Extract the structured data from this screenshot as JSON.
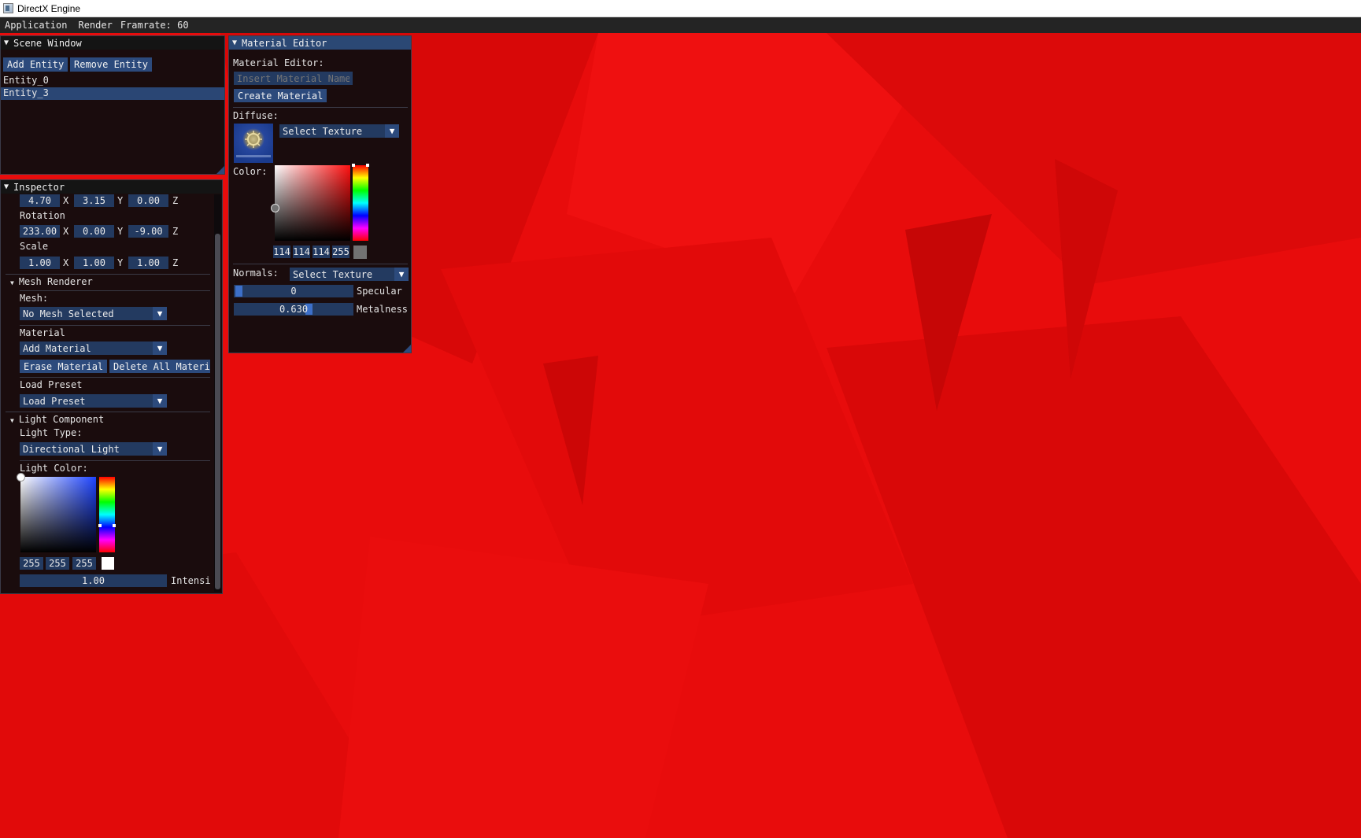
{
  "window": {
    "title": "DirectX Engine"
  },
  "menubar": {
    "items": [
      "Application",
      "Render"
    ],
    "framerate": "Framrate: 60"
  },
  "scene_window": {
    "title": "Scene Window",
    "add_button": "Add Entity",
    "remove_button": "Remove Entity",
    "entities": [
      "Entity_0",
      "Entity_3"
    ],
    "selected_entity": "Entity_3"
  },
  "inspector": {
    "title": "Inspector",
    "position": {
      "x": "4.70",
      "y": "3.15",
      "z": "0.00"
    },
    "rotation_label": "Rotation",
    "rotation": {
      "x": "233.00",
      "y": "0.00",
      "z": "-9.00"
    },
    "scale_label": "Scale",
    "scale": {
      "x": "1.00",
      "y": "1.00",
      "z": "1.00"
    },
    "axis_x": "X",
    "axis_y": "Y",
    "axis_z": "Z",
    "mesh_renderer": {
      "title": "Mesh Renderer",
      "mesh_label": "Mesh:",
      "mesh_value": "No Mesh Selected",
      "material_label": "Material",
      "material_value": "Add Material",
      "erase_button": "Erase Material",
      "delete_all_button": "Delete All Materia",
      "preset_label": "Load Preset",
      "preset_value": "Load Preset"
    },
    "light": {
      "title": "Light Component",
      "type_label": "Light Type:",
      "type_value": "Directional Light",
      "color_label": "Light Color:",
      "rgb": [
        "255",
        "255",
        "255"
      ],
      "preview_color": "#ffffff",
      "intensity": "1.00",
      "intensity_label": "Intensi"
    }
  },
  "material_editor": {
    "title": "Material Editor",
    "heading": "Material Editor:",
    "name_placeholder": "Insert Material Name",
    "create_button": "Create Material",
    "diffuse_label": "Diffuse:",
    "diffuse_texture": "Select Texture",
    "color_label": "Color:",
    "rgba": [
      "114",
      "114",
      "114",
      "255"
    ],
    "preview_color": "#727272",
    "normals_label": "Normals:",
    "normals_texture": "Select Texture",
    "specular": {
      "value": "0",
      "label": "Specular",
      "fraction": 0
    },
    "metalness": {
      "value": "0.630",
      "label": "Metalness",
      "fraction": 0.63
    }
  },
  "colors": {
    "accent": "#2c4a7c",
    "viewport": "#e80c0c",
    "panel": "#120c0e"
  }
}
